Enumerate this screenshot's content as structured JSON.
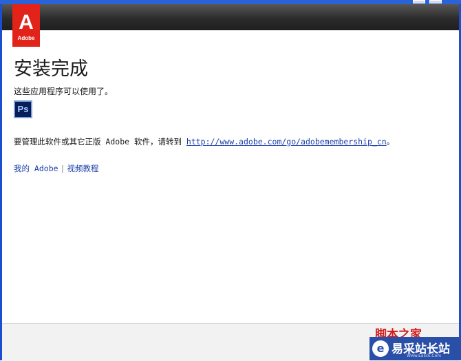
{
  "window": {
    "buttons": [
      "minimize",
      "close"
    ]
  },
  "logo": {
    "mark": "A",
    "text": "Adobe",
    "color": "#e2231a"
  },
  "main": {
    "title": "安装完成",
    "subtitle": "这些应用程序可以使用了。",
    "app_icon_text": "Ps",
    "info_prefix": "要管理此软件或其它正版 Adobe 软件，请转到 ",
    "info_link": "http://www.adobe.com/go/adobemembership_cn",
    "info_suffix": "。",
    "links": [
      "我的 Adobe",
      "视频教程"
    ],
    "link_separator": "|"
  },
  "watermark": {
    "red_text": "脚本之家",
    "brand_icon": "e",
    "brand_text": "易采站长站",
    "brand_url": "Www.Easck.Com"
  },
  "colors": {
    "window_border": "#1c4fcf",
    "link": "#1a3ea8",
    "header_dark": "#2b2b2b"
  }
}
